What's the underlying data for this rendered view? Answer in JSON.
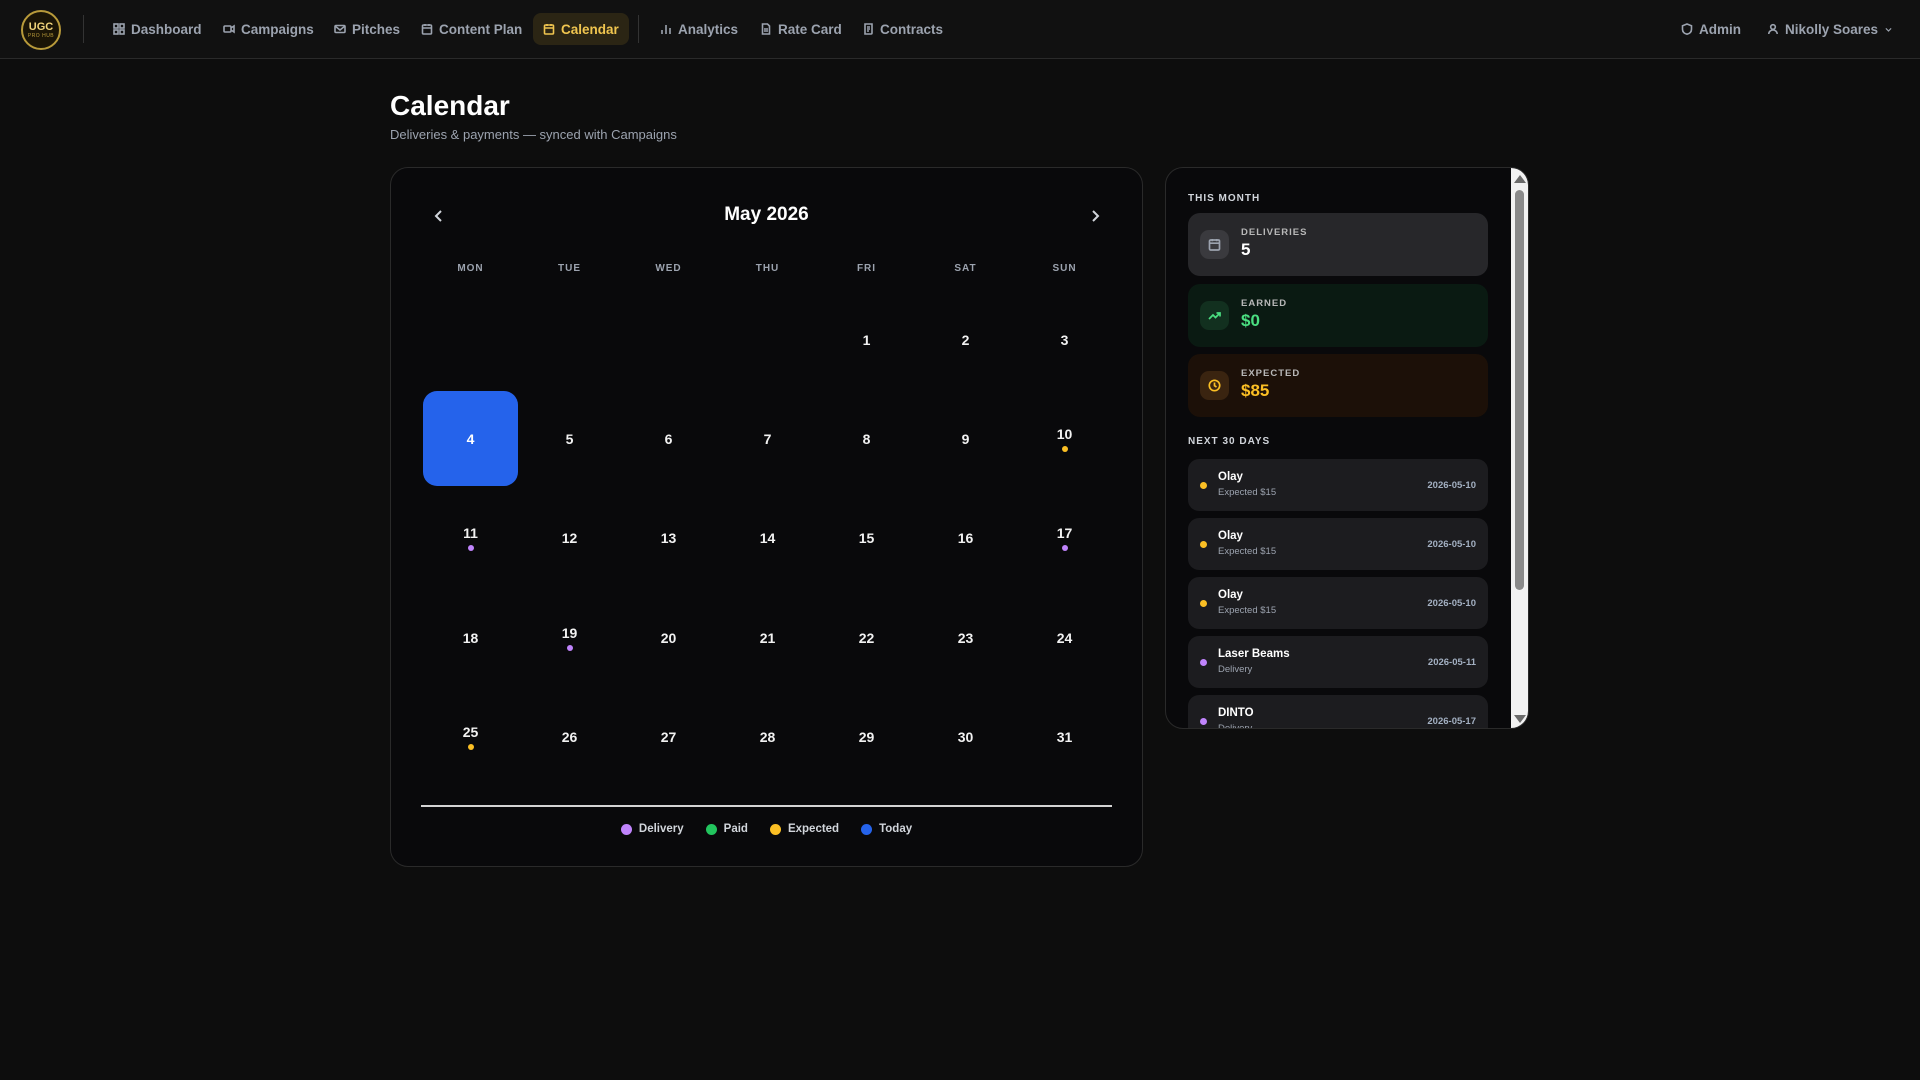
{
  "logo": {
    "line1": "UGC",
    "line2": "PRO HUB"
  },
  "nav": {
    "items": [
      {
        "label": "Dashboard",
        "icon": "grid-icon"
      },
      {
        "label": "Campaigns",
        "icon": "video-icon"
      },
      {
        "label": "Pitches",
        "icon": "mail-icon"
      },
      {
        "label": "Content Plan",
        "icon": "calendar-icon"
      },
      {
        "label": "Calendar",
        "icon": "calendar-icon",
        "active": true
      },
      {
        "label": "Analytics",
        "icon": "bar-chart-icon"
      },
      {
        "label": "Rate Card",
        "icon": "document-icon"
      },
      {
        "label": "Contracts",
        "icon": "scroll-icon"
      }
    ],
    "admin_label": "Admin",
    "user_name": "Nikolly Soares"
  },
  "page": {
    "title": "Calendar",
    "subtitle": "Deliveries & payments — synced with Campaigns"
  },
  "calendar": {
    "month_label": "May 2026",
    "weekdays": [
      "MON",
      "TUE",
      "WED",
      "THU",
      "FRI",
      "SAT",
      "SUN"
    ],
    "today": 4,
    "weeks": [
      [
        null,
        null,
        null,
        null,
        1,
        2,
        3
      ],
      [
        4,
        5,
        6,
        7,
        8,
        9,
        10
      ],
      [
        11,
        12,
        13,
        14,
        15,
        16,
        17
      ],
      [
        18,
        19,
        20,
        21,
        22,
        23,
        24
      ],
      [
        25,
        26,
        27,
        28,
        29,
        30,
        31
      ]
    ],
    "markers": {
      "10": "expected",
      "11": "delivery",
      "17": "delivery",
      "19": "delivery",
      "25": "expected"
    }
  },
  "legend": [
    {
      "label": "Delivery",
      "color": "#c084fc"
    },
    {
      "label": "Paid",
      "color": "#22c55e"
    },
    {
      "label": "Expected",
      "color": "#fbbf24"
    },
    {
      "label": "Today",
      "color": "#2563eb"
    }
  ],
  "colors": {
    "delivery": "#c084fc",
    "paid": "#22c55e",
    "expected": "#fbbf24",
    "today": "#2563eb",
    "accent": "#f0c54f"
  },
  "summary": {
    "section_label": "THIS MONTH",
    "stats": [
      {
        "label": "DELIVERIES",
        "value": "5",
        "icon": "calendar-icon",
        "bg": "#27272a",
        "icon_bg": "#3a3a3e",
        "icon_color": "#9ca3af",
        "value_color": "#ffffff"
      },
      {
        "label": "EARNED",
        "value": "$0",
        "icon": "trending-up-icon",
        "bg": "#0a1a12",
        "icon_bg": "#12301f",
        "icon_color": "#4ade80",
        "value_color": "#4ade80"
      },
      {
        "label": "EXPECTED",
        "value": "$85",
        "icon": "clock-icon",
        "bg": "#1c1008",
        "icon_bg": "#3a2410",
        "icon_color": "#fbbf24",
        "value_color": "#fbbf24"
      }
    ]
  },
  "upcoming": {
    "section_label": "NEXT 30 DAYS",
    "items": [
      {
        "name": "Olay",
        "sub": "Expected $15",
        "date": "2026-05-10",
        "kind": "expected"
      },
      {
        "name": "Olay",
        "sub": "Expected $15",
        "date": "2026-05-10",
        "kind": "expected"
      },
      {
        "name": "Olay",
        "sub": "Expected $15",
        "date": "2026-05-10",
        "kind": "expected"
      },
      {
        "name": "Laser Beams",
        "sub": "Delivery",
        "date": "2026-05-11",
        "kind": "delivery"
      },
      {
        "name": "DINTO",
        "sub": "Delivery",
        "date": "2026-05-17",
        "kind": "delivery"
      }
    ]
  }
}
